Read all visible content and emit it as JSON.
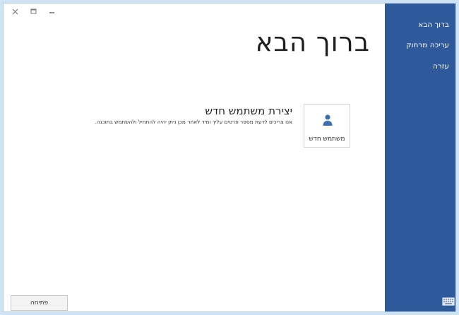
{
  "window": {
    "title": "ברוך הבא",
    "controls": [
      "close",
      "maximize",
      "minimize"
    ]
  },
  "sidebar": {
    "items": [
      {
        "label": "ברוך הבא",
        "active": true
      },
      {
        "label": "עריכה מרחוק",
        "active": false
      },
      {
        "label": "עזרה",
        "active": false
      }
    ],
    "bottom_icon": "keyboard-icon"
  },
  "main": {
    "tile": {
      "icon": "user-icon",
      "label": "משתמש חדש"
    },
    "heading": "יצירת משתמש חדש",
    "description": "אנו צריכים לדעת מספר פרטים עליך ומיד לאחר מכן ניתן יהיה להתחיל ולהשתמש בתוכנה.",
    "open_button_label": "פתיחה"
  },
  "colors": {
    "sidebar_bg": "#2e5a9c",
    "outer_bg": "#cfe3f5",
    "accent_icon": "#3a6fb0"
  }
}
